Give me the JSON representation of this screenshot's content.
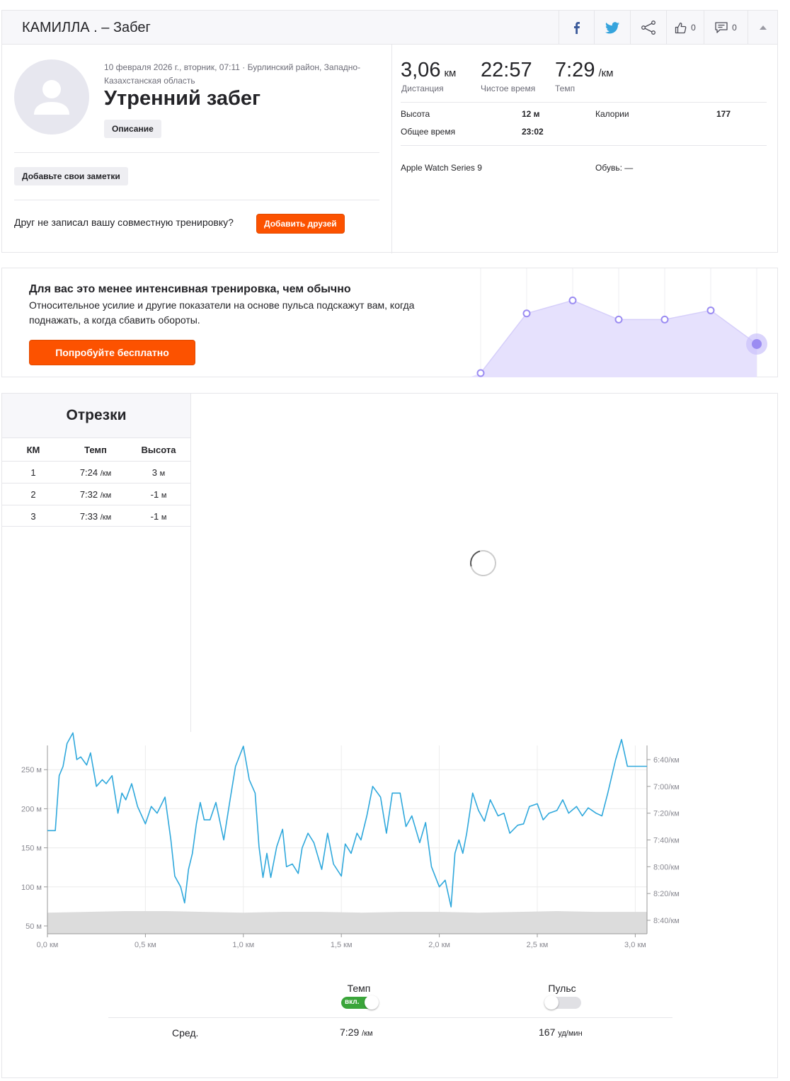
{
  "header": {
    "title": "КАМИЛЛА . – Забег",
    "kudos_count": "0",
    "comments_count": "0"
  },
  "activity": {
    "meta": "10 февраля 2026 г., вторник, 07:11 · Бурлинский район, Западно-Казахстанская область",
    "title": "Утренний забег",
    "description_label": "Описание",
    "notes_label": "Добавьте свои заметки",
    "friend_prompt": "Друг не записал вашу совместную тренировку?",
    "add_friends_label": "Добавить друзей"
  },
  "stats": {
    "distance": {
      "value": "3,06",
      "unit": "км",
      "label": "Дистанция"
    },
    "moving_time": {
      "value": "22:57",
      "label": "Чистое время"
    },
    "pace": {
      "value": "7:29",
      "unit": "/км",
      "label": "Темп"
    },
    "elevation": {
      "label": "Высота",
      "value": "12 м"
    },
    "calories": {
      "label": "Калории",
      "value": "177"
    },
    "elapsed_time": {
      "label": "Общее время",
      "value": "23:02"
    },
    "device": "Apple Watch Series 9",
    "shoes": "Обувь: —"
  },
  "promo": {
    "title": "Для вас это менее интенсивная тренировка, чем обычно",
    "text": "Относительное усилие и другие показатели на основе пульса подскажут вам, когда поднажать, а когда сбавить обороты.",
    "button": "Попробуйте бесплатно",
    "points": [
      0,
      0.78,
      0.95,
      0.7,
      0.7,
      0.82,
      0.38
    ]
  },
  "splits": {
    "title": "Отрезки",
    "headers": [
      "КМ",
      "Темп",
      "Высота"
    ],
    "rows": [
      {
        "km": "1",
        "pace": "7:24",
        "pace_unit": "/км",
        "elev": "3",
        "elev_unit": "м"
      },
      {
        "km": "2",
        "pace": "7:32",
        "pace_unit": "/км",
        "elev": "-1",
        "elev_unit": "м"
      },
      {
        "km": "3",
        "pace": "7:33",
        "pace_unit": "/км",
        "elev": "-1",
        "elev_unit": "м"
      }
    ]
  },
  "chart_data": {
    "type": "line",
    "x_ticks": [
      "0,0 км",
      "0,5 км",
      "1,0 км",
      "1,5 км",
      "2,0 км",
      "2,5 км",
      "3,0 км"
    ],
    "x_tick_values": [
      0,
      0.5,
      1.0,
      1.5,
      2.0,
      2.5,
      3.0
    ],
    "xlim": [
      0,
      3.06
    ],
    "y_left_ticks": [
      "250 м",
      "200 м",
      "150 м",
      "100 м",
      "50 м"
    ],
    "y_left_values": [
      250,
      200,
      150,
      100,
      50
    ],
    "ylim_left": [
      40,
      281
    ],
    "y_right_ticks": [
      "6:40/км",
      "7:00/км",
      "7:20/км",
      "7:40/км",
      "8:00/км",
      "8:20/км",
      "8:40/км"
    ],
    "y_right_values": [
      400,
      420,
      440,
      460,
      480,
      500,
      520
    ],
    "elevation_profile": {
      "x": [
        0,
        0.2,
        0.4,
        0.6,
        0.8,
        1.0,
        1.2,
        1.4,
        1.6,
        1.8,
        2.0,
        2.2,
        2.4,
        2.6,
        2.8,
        3.0,
        3.06
      ],
      "y": [
        67,
        68,
        69,
        69,
        68,
        67,
        68,
        68,
        67,
        68,
        68,
        67,
        68,
        69,
        68,
        68,
        68
      ]
    },
    "series": [
      {
        "x": [
          0,
          0.04,
          0.06,
          0.08,
          0.1,
          0.13,
          0.15,
          0.17,
          0.2,
          0.22,
          0.25,
          0.28,
          0.3,
          0.33,
          0.36,
          0.38,
          0.4,
          0.43,
          0.46,
          0.5,
          0.53,
          0.56,
          0.6,
          0.63,
          0.65,
          0.68,
          0.7,
          0.72,
          0.74,
          0.76,
          0.78,
          0.8,
          0.83,
          0.86,
          0.9,
          0.93,
          0.96,
          1.0,
          1.03,
          1.06,
          1.08,
          1.1,
          1.12,
          1.14,
          1.17,
          1.2,
          1.22,
          1.25,
          1.28,
          1.3,
          1.33,
          1.36,
          1.4,
          1.43,
          1.46,
          1.5,
          1.52,
          1.55,
          1.58,
          1.6,
          1.63,
          1.66,
          1.7,
          1.73,
          1.76,
          1.8,
          1.83,
          1.86,
          1.9,
          1.93,
          1.96,
          2.0,
          2.03,
          2.06,
          2.08,
          2.1,
          2.12,
          2.14,
          2.17,
          2.2,
          2.23,
          2.26,
          2.3,
          2.33,
          2.36,
          2.4,
          2.43,
          2.46,
          2.5,
          2.53,
          2.56,
          2.6,
          2.63,
          2.66,
          2.7,
          2.73,
          2.76,
          2.8,
          2.83,
          2.86,
          2.9,
          2.93,
          2.96,
          3.0,
          3.03,
          3.06
        ],
        "y": [
          453,
          453,
          412,
          405,
          388,
          380,
          400,
          398,
          404,
          395,
          420,
          415,
          418,
          412,
          440,
          425,
          430,
          418,
          435,
          448,
          435,
          440,
          428,
          460,
          487,
          495,
          507,
          482,
          470,
          448,
          432,
          445,
          445,
          432,
          460,
          432,
          405,
          390,
          415,
          425,
          465,
          488,
          470,
          488,
          465,
          452,
          480,
          478,
          485,
          466,
          455,
          462,
          482,
          455,
          478,
          487,
          463,
          470,
          455,
          460,
          442,
          420,
          428,
          455,
          425,
          425,
          450,
          442,
          462,
          447,
          480,
          495,
          490,
          510,
          470,
          460,
          470,
          455,
          425,
          438,
          446,
          430,
          442,
          440,
          455,
          449,
          448,
          435,
          433,
          445,
          440,
          438,
          430,
          440,
          435,
          442,
          436,
          440,
          442,
          425,
          400,
          385,
          405,
          405,
          405,
          405
        ],
        "color": "#2fa8dc"
      }
    ]
  },
  "chart_controls": {
    "pace_label": "Темп",
    "pace_toggle_text": "вкл.",
    "hr_label": "Пульс",
    "avg_label": "Сред.",
    "avg_pace": "7:29",
    "avg_pace_unit": "/км",
    "avg_hr": "167",
    "avg_hr_unit": "уд/мин"
  },
  "colors": {
    "accent": "#fc5200",
    "pace_line": "#2fa8dc",
    "elevation_fill": "#dcdcdc",
    "promo_fill": "#e6e1fd",
    "promo_point": "#9b8cf2",
    "toggle_on": "#3aa53a"
  }
}
